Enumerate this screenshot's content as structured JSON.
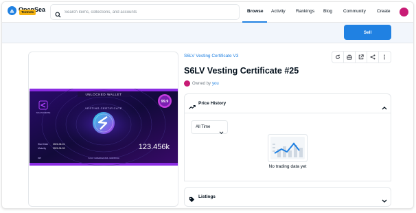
{
  "navbar": {
    "brand": "OpenSea",
    "badge": "Testnets",
    "search_placeholder": "Search items, collections, and accounts",
    "links": [
      "Browse",
      "Activity",
      "Rankings",
      "Blog",
      "Community",
      "Create"
    ],
    "active_link": "Browse",
    "accent_color": "#2081e2"
  },
  "sellbar": {
    "sell_label": "Sell"
  },
  "nft": {
    "collection": "S6LV Vesting Certificate V3",
    "title": "S6LV Vesting Certificate #25",
    "owned_by_label": "Owned by",
    "owner": "you",
    "image": {
      "top_banner": "UNLOCKED WALLET",
      "badge_value": "99.9",
      "certificate_label": "VESTING CERTIFICATE",
      "logo_label": "SOLUNAVERSE",
      "start_label": "Start Date",
      "start_value": "2021-06-01",
      "maturity_label": "Maturity",
      "maturity_value": "2021-06-03",
      "amount": "123.456k",
      "token_id": "#25",
      "owner_line": "Owner: 0x98a804e6c6d6...ffe8d3b1bde"
    }
  },
  "actions": [
    "refresh-icon",
    "transfer-icon",
    "external-link-icon",
    "share-icon",
    "more-icon"
  ],
  "price_history": {
    "title": "Price History",
    "time_filter": "All Time",
    "empty_text": "No trading data yet"
  },
  "listings": {
    "title": "Listings"
  }
}
